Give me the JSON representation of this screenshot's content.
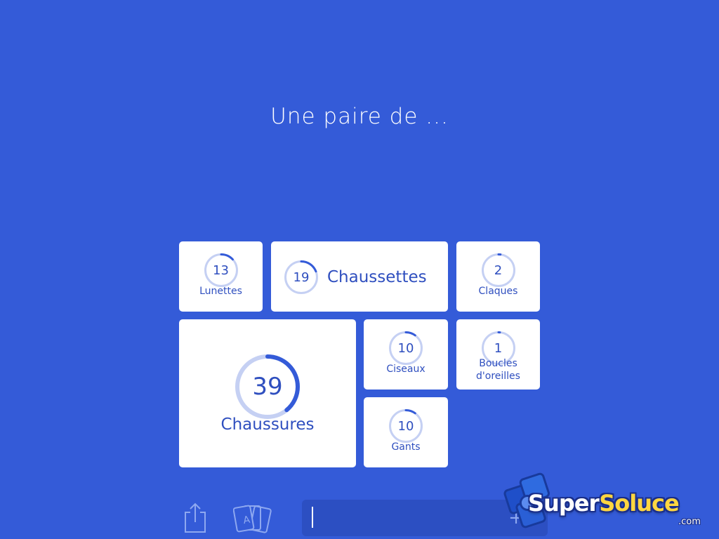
{
  "question": "Une paire de ...",
  "answers": {
    "lunettes": {
      "count": "13",
      "label": "Lunettes",
      "progress": 0.13
    },
    "chaussettes": {
      "count": "19",
      "label": "Chaussettes",
      "progress": 0.19
    },
    "claques": {
      "count": "2",
      "label": "Claques",
      "progress": 0.02
    },
    "chaussures": {
      "count": "39",
      "label": "Chaussures",
      "progress": 0.39
    },
    "ciseaux": {
      "count": "10",
      "label": "Ciseaux",
      "progress": 0.1
    },
    "boucles": {
      "count": "1",
      "label": "Boucles d'oreilles",
      "label_line1": "Boucles",
      "label_line2": "d'oreilles",
      "progress": 0.01
    },
    "gants": {
      "count": "10",
      "label": "Gants",
      "progress": 0.1
    }
  },
  "toolbar": {
    "share_icon": "share-icon",
    "cards_icon": "cards-icon",
    "answer_value": "",
    "plus_icon": "+"
  },
  "watermark": {
    "super": "Super",
    "soluce": "Soluce",
    "dotcom": ".com"
  },
  "colors": {
    "background": "#345bd8",
    "tile": "#ffffff",
    "text_accent": "#2f4fbf",
    "ring_track": "#c5d0f3",
    "ring_fill": "#345bd8"
  }
}
